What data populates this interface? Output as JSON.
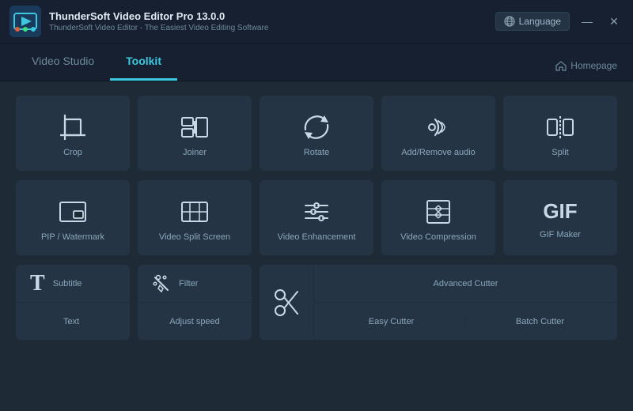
{
  "titleBar": {
    "appName": "ThunderSoft Video Editor Pro 13.0.0",
    "subtitle": "ThunderSoft Video Editor - The Easiest Video Editing Software",
    "languageBtn": "Language",
    "minimizeBtn": "—",
    "closeBtn": "✕"
  },
  "nav": {
    "tabs": [
      {
        "id": "video-studio",
        "label": "Video Studio",
        "active": false
      },
      {
        "id": "toolkit",
        "label": "Toolkit",
        "active": true
      }
    ],
    "homepageLabel": "Homepage"
  },
  "tools": {
    "row1": [
      {
        "id": "crop",
        "label": "Crop",
        "icon": "crop"
      },
      {
        "id": "joiner",
        "label": "Joiner",
        "icon": "joiner"
      },
      {
        "id": "rotate",
        "label": "Rotate",
        "icon": "rotate"
      },
      {
        "id": "add-remove-audio",
        "label": "Add/Remove audio",
        "icon": "audio"
      },
      {
        "id": "split",
        "label": "Split",
        "icon": "split"
      }
    ],
    "row2": [
      {
        "id": "pip-watermark",
        "label": "PIP / Watermark",
        "icon": "pip"
      },
      {
        "id": "video-split-screen",
        "label": "Video Split Screen",
        "icon": "split-screen"
      },
      {
        "id": "video-enhancement",
        "label": "Video Enhancement",
        "icon": "enhancement"
      },
      {
        "id": "video-compression",
        "label": "Video Compression",
        "icon": "compression"
      },
      {
        "id": "gif-maker",
        "label": "GIF Maker",
        "icon": "gif"
      }
    ],
    "row3": {
      "textSubtitle": {
        "subtitle": "Subtitle",
        "text": "Text"
      },
      "filterAdjust": {
        "filter": "Filter",
        "adjustSpeed": "Adjust speed"
      },
      "cutters": {
        "advancedCutter": "Advanced Cutter",
        "easyCutter": "Easy Cutter",
        "batchCutter": "Batch Cutter"
      }
    }
  }
}
